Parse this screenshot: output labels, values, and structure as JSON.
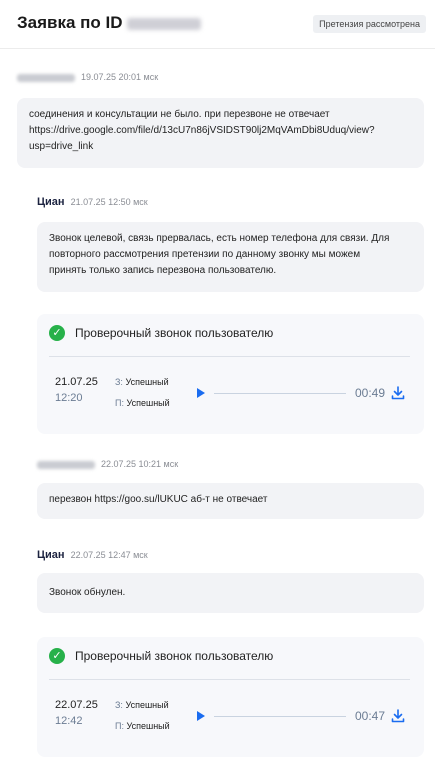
{
  "header": {
    "title": "Заявка по ID",
    "badge": "Претензия рассмотрена"
  },
  "messages": [
    {
      "author": "",
      "timestamp": "19.07.25 20:01 мск",
      "text": "соединения и консультации не было. при перезвоне не отвечает\nhttps://drive.google.com/file/d/13cU7n86jVSIDST90lj2MqVAmDbi8Uduq/view?\nusp=drive_link"
    },
    {
      "author": "Циан",
      "timestamp": "21.07.25 12:50 мск",
      "text": "Звонок целевой, связь прервалась, есть номер телефона для связи. Для\nповторного рассмотрения претензии по данному звонку мы можем\nпринять только запись перезвона пользователю."
    },
    {
      "author": "",
      "timestamp": "22.07.25 10:21 мск",
      "text": "перезвон https://goo.su/lUKUC аб-т не отвечает"
    },
    {
      "author": "Циан",
      "timestamp": "22.07.25 12:47 мск",
      "text": "Звонок обнулен."
    }
  ],
  "call_cards": [
    {
      "title": "Проверочный звонок пользователю",
      "date": "21.07.25",
      "time": "12:20",
      "status1_prefix": "З:",
      "status1": "Успешный",
      "status2_prefix": "П:",
      "status2": "Успешный",
      "duration": "00:49"
    },
    {
      "title": "Проверочный звонок пользователю",
      "date": "22.07.25",
      "time": "12:42",
      "status1_prefix": "З:",
      "status1": "Успешный",
      "status2_prefix": "П:",
      "status2": "Успешный",
      "duration": "00:47"
    }
  ],
  "icons": {
    "check": "check-circle-icon",
    "play": "play-icon",
    "download": "download-icon"
  },
  "colors": {
    "accent": "#1a6cf0",
    "success": "#27b14a",
    "bubble_bg": "#f2f3f6"
  }
}
